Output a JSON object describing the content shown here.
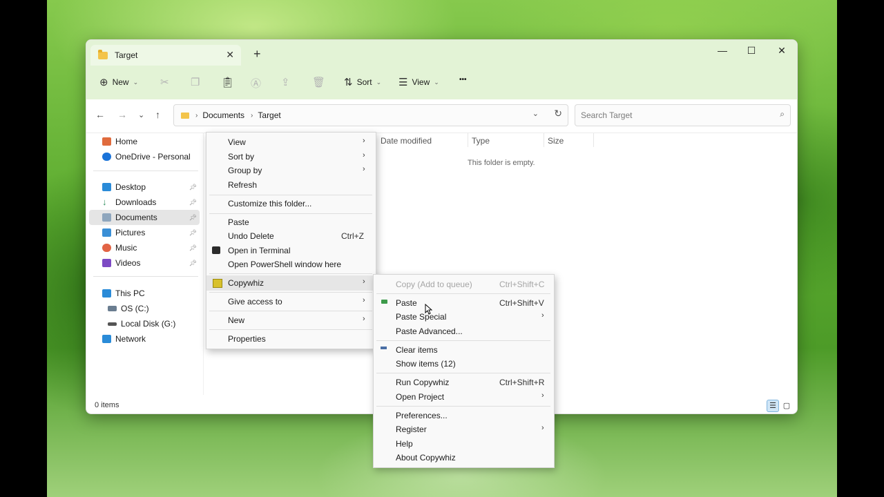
{
  "window": {
    "tab_title": "Target",
    "tab_close": "✕",
    "tab_add": "+",
    "controls": {
      "minimize": "—",
      "maximize": "☐",
      "close": "✕"
    }
  },
  "toolbar": {
    "new_label": "New",
    "sort_label": "Sort",
    "view_label": "View",
    "more_label": "•••"
  },
  "address": {
    "crumbs": [
      "Documents",
      "Target"
    ],
    "search_placeholder": "Search Target"
  },
  "sidebar": {
    "items": [
      {
        "label": "Home",
        "color": "#e06b3d"
      },
      {
        "label": "OneDrive - Personal",
        "color": "#1a73d9"
      },
      {
        "label": "Desktop",
        "color": "#2a8bd8"
      },
      {
        "label": "Downloads",
        "color": "#2a8c5a"
      },
      {
        "label": "Documents",
        "color": "#8fa6bd"
      },
      {
        "label": "Pictures",
        "color": "#3a8fd6"
      },
      {
        "label": "Music",
        "color": "#e26445"
      },
      {
        "label": "Videos",
        "color": "#7d4ac4"
      },
      {
        "label": "This PC",
        "color": "#2a8bd8"
      },
      {
        "label": "OS (C:)",
        "color": "#6a7d90"
      },
      {
        "label": "Local Disk (G:)",
        "color": "#555555"
      },
      {
        "label": "Network",
        "color": "#2a8bd8"
      }
    ]
  },
  "columns": [
    "Date modified",
    "Type",
    "Size"
  ],
  "empty_message": "This folder is empty.",
  "status": {
    "items_count": "0 items"
  },
  "context_menu": {
    "view": "View",
    "sort_by": "Sort by",
    "group_by": "Group by",
    "refresh": "Refresh",
    "customize": "Customize this folder...",
    "paste": "Paste",
    "undo_delete": "Undo Delete",
    "undo_shortcut": "Ctrl+Z",
    "open_terminal": "Open in Terminal",
    "open_powershell": "Open PowerShell window here",
    "copywhiz": "Copywhiz",
    "give_access": "Give access to",
    "new": "New",
    "properties": "Properties"
  },
  "submenu": {
    "copy_queue": "Copy (Add to queue)",
    "copy_queue_shortcut": "Ctrl+Shift+C",
    "paste": "Paste",
    "paste_shortcut": "Ctrl+Shift+V",
    "paste_special": "Paste Special",
    "paste_advanced": "Paste Advanced...",
    "clear_items": "Clear items",
    "show_items": "Show items (12)",
    "run_copywhiz": "Run Copywhiz",
    "run_shortcut": "Ctrl+Shift+R",
    "open_project": "Open Project",
    "preferences": "Preferences...",
    "register": "Register",
    "help": "Help",
    "about": "About Copywhiz"
  }
}
